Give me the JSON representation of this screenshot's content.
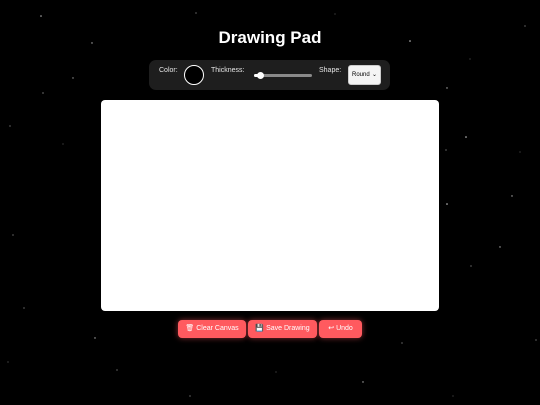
{
  "title": "Drawing Pad",
  "toolbar": {
    "color_label": "Color:",
    "color_value": "#000000",
    "thickness_label": "Thickness:",
    "thickness_fraction": 0.12,
    "shape_label": "Shape:",
    "shape_selected": "Round"
  },
  "buttons": {
    "clear": {
      "icon": "trash-icon",
      "glyph": "🗑",
      "label": "Clear Canvas"
    },
    "save": {
      "icon": "floppy-disk-icon",
      "glyph": "💾",
      "label": "Save Drawing"
    },
    "undo": {
      "icon": "undo-icon",
      "glyph": "↩",
      "label": "Undo"
    }
  },
  "colors": {
    "background": "#000000",
    "toolbar": "#1e1e1e",
    "canvas": "#ffffff",
    "button": "#ff5a5f"
  }
}
